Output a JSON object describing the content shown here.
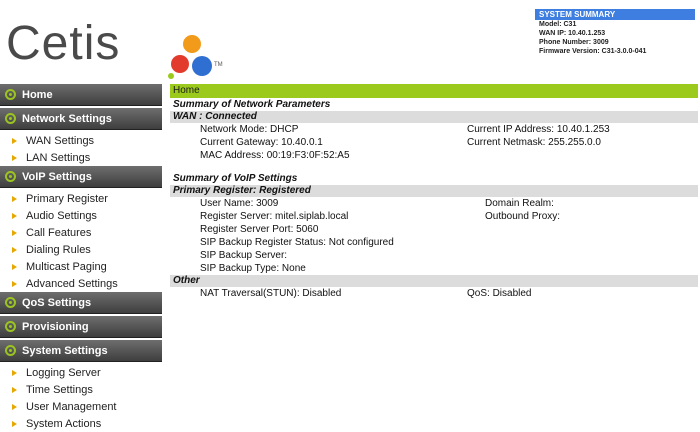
{
  "logo": {
    "text": "Cetis",
    "tm": "TM"
  },
  "summary": {
    "title": "SYSTEM SUMMARY",
    "model": "Model: C31",
    "wan_ip": "WAN IP: 10.40.1.253",
    "phone": "Phone Number: 3009",
    "firmware": "Firmware Version: C31-3.0.0-041"
  },
  "colors": {
    "accent_green": "#9bc91c",
    "summary_blue": "#3d7ee0",
    "arrow_orange": "#e6a700"
  },
  "sidebar": {
    "home": "Home",
    "network": "Network Settings",
    "network_items": [
      "WAN Settings",
      "LAN Settings"
    ],
    "voip": "VoIP Settings",
    "voip_items": [
      "Primary Register",
      "Audio Settings",
      "Call Features",
      "Dialing Rules",
      "Multicast Paging",
      "Advanced Settings"
    ],
    "qos": "QoS Settings",
    "provisioning": "Provisioning",
    "system": "System Settings",
    "system_items": [
      "Logging Server",
      "Time Settings",
      "User Management",
      "System Actions"
    ]
  },
  "main": {
    "breadcrumb": "Home",
    "network_title": "Summary of Network Parameters",
    "wan_bar": "WAN : Connected",
    "wan": {
      "mode": "Network Mode: DHCP",
      "gateway": "Current Gateway: 10.40.0.1",
      "mac": "MAC Address: 00:19:F3:0F:52:A5",
      "ip": "Current IP Address: 10.40.1.253",
      "netmask": "Current Netmask: 255.255.0.0"
    },
    "voip_title": "Summary of VoIP Settings",
    "primary_bar": "Primary Register: Registered",
    "primary": {
      "user": "User Name: 3009",
      "server": "Register Server: mitel.siplab.local",
      "port": "Register Server Port: 5060",
      "backup_status": "SIP Backup Register Status: Not configured",
      "backup_server": "SIP Backup Server:",
      "backup_type": "SIP Backup Type: None",
      "realm": "Domain Realm:",
      "proxy": "Outbound Proxy:"
    },
    "other_bar": "Other",
    "other": {
      "nat": "NAT Traversal(STUN): Disabled",
      "qos": "QoS: Disabled"
    }
  }
}
